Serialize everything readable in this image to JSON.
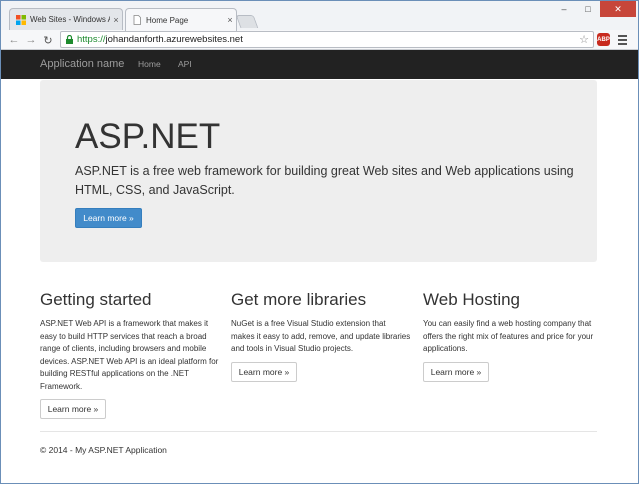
{
  "browser": {
    "tabs": [
      {
        "title": "Web Sites - Windows Azu",
        "close": "×",
        "active": false
      },
      {
        "title": "Home Page",
        "close": "×",
        "active": true
      }
    ],
    "url_scheme": "https://",
    "url_rest": "johandanforth.azurewebsites.net",
    "back": "←",
    "forward": "→",
    "reload": "↻",
    "star": "☆",
    "abp_label": "ABP",
    "window_controls": {
      "minimize": "–",
      "maximize": "□",
      "close": "✕"
    }
  },
  "navbar": {
    "brand": "Application name",
    "links": [
      "Home",
      "API"
    ]
  },
  "jumbotron": {
    "title": "ASP.NET",
    "lead": "ASP.NET is a free web framework for building great Web sites and Web applications using HTML, CSS, and JavaScript.",
    "button": "Learn more »"
  },
  "columns": [
    {
      "heading": "Getting started",
      "text": "ASP.NET Web API is a framework that makes it easy to build HTTP services that reach a broad range of clients, including browsers and mobile devices. ASP.NET Web API is an ideal platform for building RESTful applications on the .NET Framework.",
      "button": "Learn more »"
    },
    {
      "heading": "Get more libraries",
      "text": "NuGet is a free Visual Studio extension that makes it easy to add, remove, and update libraries and tools in Visual Studio projects.",
      "button": "Learn more »"
    },
    {
      "heading": "Web Hosting",
      "text": "You can easily find a web hosting company that offers the right mix of features and price for your applications.",
      "button": "Learn more »"
    }
  ],
  "footer": {
    "text": "© 2014 - My ASP.NET Application"
  },
  "colors": {
    "navbar_bg": "#222222",
    "jumbotron_bg": "#eeeeee",
    "primary": "#428bca",
    "url_secure": "#1d8a2e"
  }
}
